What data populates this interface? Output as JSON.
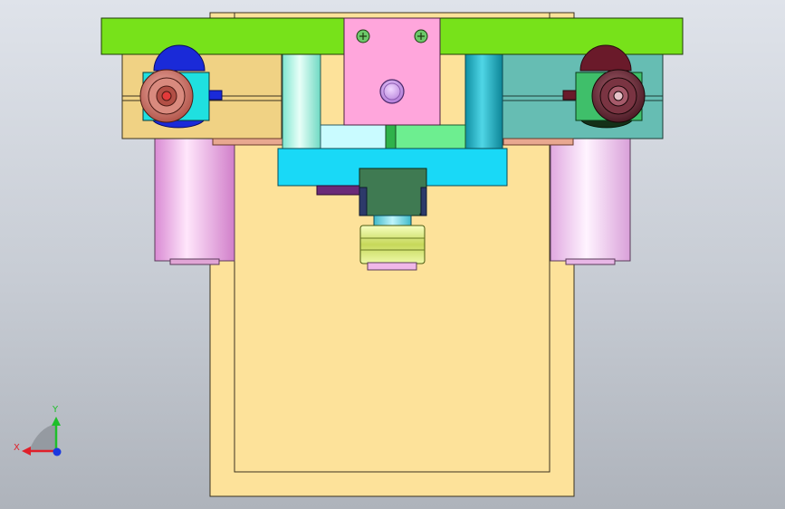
{
  "viewport": {
    "background_top": "#dfe3ea",
    "background_bottom": "#aeb3bb"
  },
  "colors": {
    "base_plate": "#fde29a",
    "top_bar": "#77e21a",
    "left_housing": "#f0d284",
    "right_housing": "#66bdb3",
    "pink_block": "#ffa6dc",
    "cyan_plate": "#19d9f7",
    "green_block": "#3f7a52",
    "purple_lever": "#6a2a78",
    "left_cylinder": "#f5b5ef",
    "right_cylinder": "#f5cdf5",
    "column_left": "#b8f6e6",
    "column_right": "#1fb6c9",
    "coupling": "#d8e86a",
    "knob_left": "#c9756a",
    "knob_right": "#6b2d3a",
    "washer": "#e8a890"
  },
  "triad": {
    "x_label": "X",
    "y_label": "Y",
    "x_color": "#e0202a",
    "y_color": "#1fbf2a",
    "z_color": "#1a38e0"
  }
}
